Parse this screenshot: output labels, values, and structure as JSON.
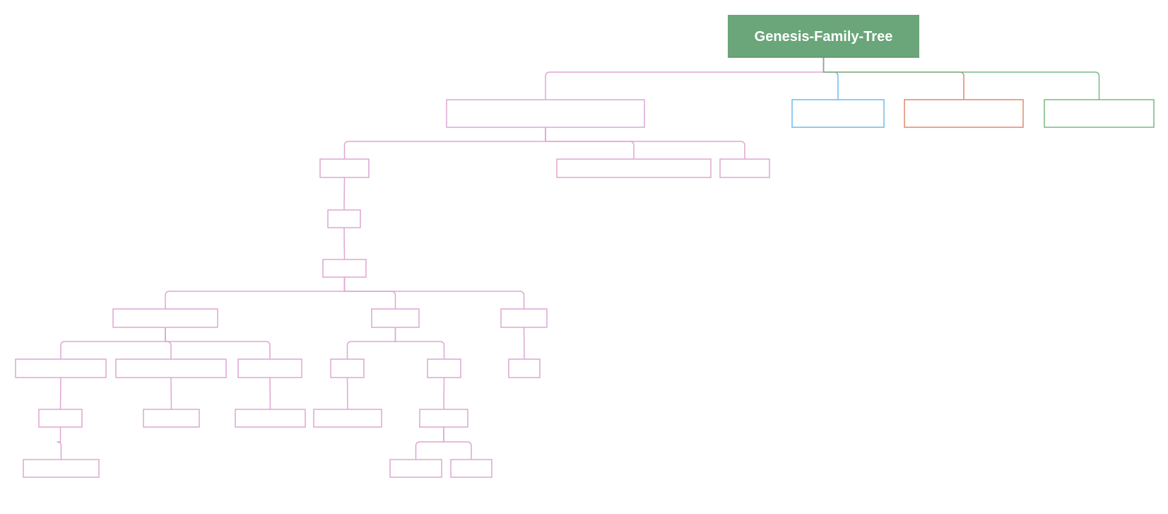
{
  "title": "Genesis-Family-Tree",
  "colors": {
    "root_fill": "#6aa67a",
    "pink": "#dfa6d4",
    "blue": "#6fbbeb",
    "orange": "#e08870",
    "green": "#78b887"
  },
  "root": {
    "label": "Genesis-Family-Tree"
  },
  "branches": [
    {
      "id": "b1",
      "color": "pink",
      "label": ""
    },
    {
      "id": "b2",
      "color": "blue",
      "label": ""
    },
    {
      "id": "b3",
      "color": "orange",
      "label": ""
    },
    {
      "id": "b4",
      "color": "green",
      "label": ""
    }
  ],
  "nodes": [
    {
      "id": "n1",
      "parent": "b1",
      "label": ""
    },
    {
      "id": "n2",
      "parent": "b1",
      "label": ""
    },
    {
      "id": "n3",
      "parent": "b1",
      "label": ""
    },
    {
      "id": "n4",
      "parent": "n1",
      "label": ""
    },
    {
      "id": "n5",
      "parent": "n4",
      "label": ""
    },
    {
      "id": "n6",
      "parent": "n5",
      "label": ""
    },
    {
      "id": "n7",
      "parent": "n5",
      "label": ""
    },
    {
      "id": "n8",
      "parent": "n5",
      "label": ""
    },
    {
      "id": "n9",
      "parent": "n6",
      "label": ""
    },
    {
      "id": "n10",
      "parent": "n6",
      "label": ""
    },
    {
      "id": "n11",
      "parent": "n6",
      "label": ""
    },
    {
      "id": "n12",
      "parent": "n9",
      "label": ""
    },
    {
      "id": "n13",
      "parent": "n12",
      "label": ""
    },
    {
      "id": "n14",
      "parent": "n10",
      "label": ""
    },
    {
      "id": "n15",
      "parent": "n11",
      "label": ""
    },
    {
      "id": "n16",
      "parent": "n7",
      "label": ""
    },
    {
      "id": "n17",
      "parent": "n7",
      "label": ""
    },
    {
      "id": "n18",
      "parent": "n16",
      "label": ""
    },
    {
      "id": "n19",
      "parent": "n17",
      "label": ""
    },
    {
      "id": "n20",
      "parent": "n19",
      "label": ""
    },
    {
      "id": "n21",
      "parent": "n19",
      "label": ""
    },
    {
      "id": "n22",
      "parent": "n8",
      "label": ""
    }
  ]
}
